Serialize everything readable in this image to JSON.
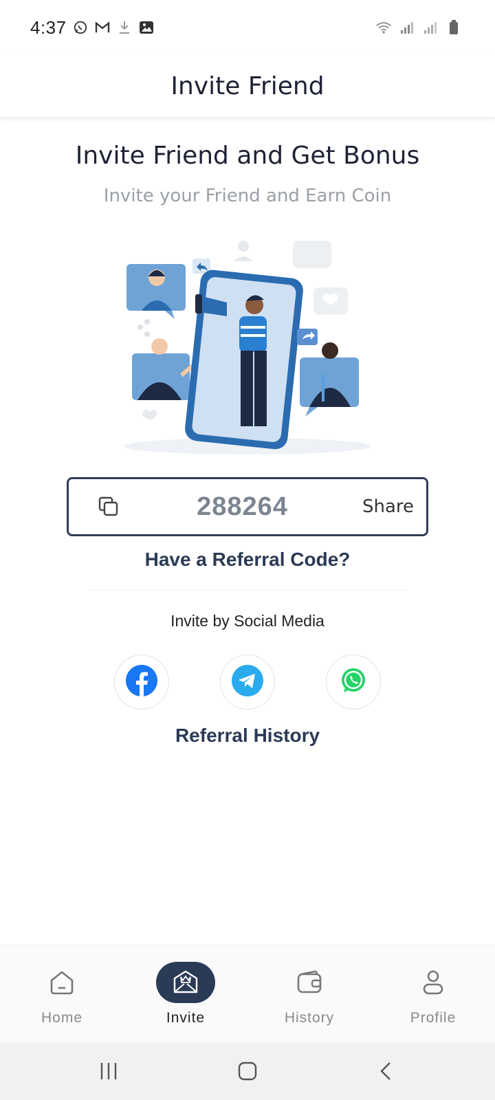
{
  "status_bar": {
    "time": "4:37",
    "left_icons": [
      "whatsapp-icon",
      "gmail-icon",
      "download-icon",
      "image-icon"
    ],
    "right_icons": [
      "wifi-icon",
      "signal-icon",
      "signal-icon",
      "battery-icon"
    ]
  },
  "app_bar": {
    "title": "Invite Friend"
  },
  "hero": {
    "title": "Invite Friend and Get Bonus",
    "subtitle": "Invite your Friend and Earn Coin"
  },
  "referral": {
    "code": "288264",
    "share_label": "Share",
    "have_code_label": "Have a Referral Code?"
  },
  "social": {
    "title": "Invite by Social Media",
    "buttons": [
      {
        "name": "facebook",
        "icon": "facebook-icon",
        "color": "#1877F2"
      },
      {
        "name": "telegram",
        "icon": "telegram-icon",
        "color": "#2AABEE"
      },
      {
        "name": "whatsapp",
        "icon": "whatsapp-icon",
        "color": "#25D366"
      }
    ]
  },
  "history_link": "Referral History",
  "bottom_nav": {
    "active": "Invite",
    "items": [
      {
        "label": "Home",
        "icon": "home-icon"
      },
      {
        "label": "Invite",
        "icon": "invite-icon"
      },
      {
        "label": "History",
        "icon": "wallet-icon"
      },
      {
        "label": "Profile",
        "icon": "profile-icon"
      }
    ]
  },
  "colors": {
    "primary": "#2b3a55",
    "muted": "#9aa0a6"
  }
}
